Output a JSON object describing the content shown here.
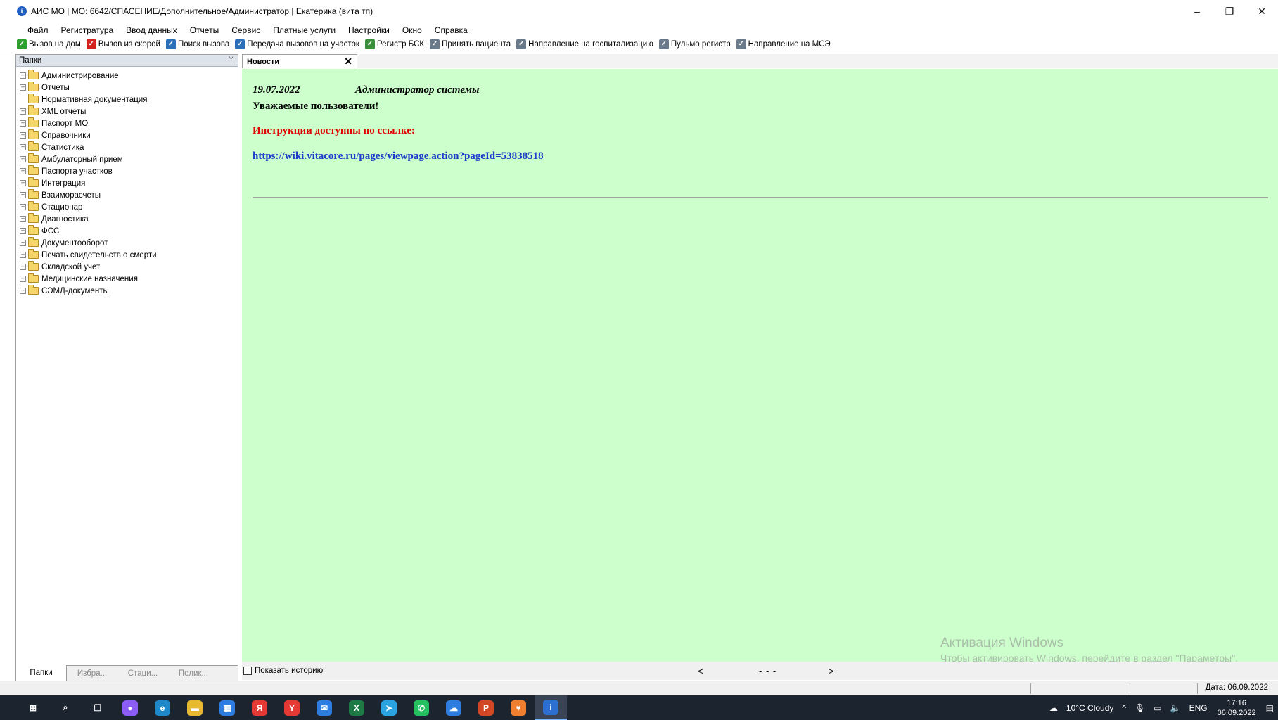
{
  "window": {
    "title": "АИС МО | МО: 6642/СПАСЕНИЕ/Дополнительное/Администратор | Екатерика (вита тп)",
    "minimize": "–",
    "restore": "❐",
    "close": "✕"
  },
  "menu": [
    "Файл",
    "Регистратура",
    "Ввод данных",
    "Отчеты",
    "Сервис",
    "Платные услуги",
    "Настройки",
    "Окно",
    "Справка"
  ],
  "toolbar": [
    {
      "label": "Вызов на дом",
      "icon": "checkmark-icon",
      "color": "#2e9e2e"
    },
    {
      "label": "Вызов из скорой",
      "icon": "ambulance-check-icon",
      "color": "#d22020"
    },
    {
      "label": "Поиск вызова",
      "icon": "search-call-icon",
      "color": "#2a6fb8"
    },
    {
      "label": "Передача вызовов на участок",
      "icon": "transfer-icon",
      "color": "#2a6fb8"
    },
    {
      "label": "Регистр БСК",
      "icon": "register-icon",
      "color": "#3a8f3a"
    },
    {
      "label": "Принять пациента",
      "icon": "accept-patient-icon",
      "color": "#6a7a8a"
    },
    {
      "label": "Направление на госпитализацию",
      "icon": "hospitalization-icon",
      "color": "#6a7a8a"
    },
    {
      "label": "Пульмо регистр",
      "icon": "lungs-icon",
      "color": "#6a7a8a"
    },
    {
      "label": "Направление на МСЭ",
      "icon": "mse-referral-icon",
      "color": "#6a7a8a"
    }
  ],
  "left_panel": {
    "title": "Папки",
    "pin": "📌",
    "folders": [
      {
        "label": "Администрирование",
        "expandable": true
      },
      {
        "label": "Отчеты",
        "expandable": true
      },
      {
        "label": "Нормативная документация",
        "expandable": false
      },
      {
        "label": "XML отчеты",
        "expandable": true
      },
      {
        "label": "Паспорт МО",
        "expandable": true
      },
      {
        "label": "Справочники",
        "expandable": true
      },
      {
        "label": "Статистика",
        "expandable": true
      },
      {
        "label": "Амбулаторный прием",
        "expandable": true
      },
      {
        "label": "Паспорта участков",
        "expandable": true
      },
      {
        "label": "Интеграция",
        "expandable": true
      },
      {
        "label": "Взаиморасчеты",
        "expandable": true
      },
      {
        "label": "Стационар",
        "expandable": true
      },
      {
        "label": "Диагностика",
        "expandable": true
      },
      {
        "label": "ФСС",
        "expandable": true
      },
      {
        "label": "Документооборот",
        "expandable": true
      },
      {
        "label": "Печать свидетельств о смерти",
        "expandable": true
      },
      {
        "label": "Складской учет",
        "expandable": true
      },
      {
        "label": "Медицинские назначения",
        "expandable": true
      },
      {
        "label": "СЭМД-документы",
        "expandable": true
      }
    ],
    "bottom_tabs": [
      "Папки",
      "Избра...",
      "Стаци...",
      "Полик..."
    ]
  },
  "doc_tab": {
    "label": "Новости",
    "close": "✕"
  },
  "news": {
    "date": "19.07.2022",
    "author": "Администратор системы",
    "greeting": "Уважаемые пользователи!",
    "instructions": "Инструкции доступны по ссылке:",
    "link": "https://wiki.vitacore.ru/pages/viewpage.action?pageId=53838518"
  },
  "activation": {
    "title": "Активация Windows",
    "subtitle": "Чтобы активировать Windows, перейдите в раздел \"Параметры\"."
  },
  "footer": {
    "show_history": "Показать историю",
    "prev": "<",
    "middle": "- - -",
    "next": ">"
  },
  "statusbar": {
    "date": "Дата: 06.09.2022"
  },
  "taskbar": {
    "apps": [
      {
        "name": "windows-start-icon",
        "color": "#1c2430",
        "glyph": "⊞"
      },
      {
        "name": "search-icon",
        "color": "#1c2430",
        "glyph": "⌕"
      },
      {
        "name": "task-view-icon",
        "color": "#1c2430",
        "glyph": "❐"
      },
      {
        "name": "alice-icon",
        "color": "#8b5cf6",
        "glyph": "●"
      },
      {
        "name": "edge-icon",
        "color": "#1e88c8",
        "glyph": "e"
      },
      {
        "name": "file-explorer-icon",
        "color": "#e8b830",
        "glyph": "▬"
      },
      {
        "name": "store-icon",
        "color": "#2d7de0",
        "glyph": "▦"
      },
      {
        "name": "yandex-icon",
        "color": "#e53935",
        "glyph": "Я"
      },
      {
        "name": "yandex-browser-icon",
        "color": "#e53935",
        "glyph": "Y"
      },
      {
        "name": "mail-icon",
        "color": "#2d7de0",
        "glyph": "✉"
      },
      {
        "name": "excel-icon",
        "color": "#1d7a45",
        "glyph": "X"
      },
      {
        "name": "telegram-icon",
        "color": "#2aa3e0",
        "glyph": "➤"
      },
      {
        "name": "whatsapp-icon",
        "color": "#25c060",
        "glyph": "✆"
      },
      {
        "name": "onedrive-icon",
        "color": "#2d7de0",
        "glyph": "☁"
      },
      {
        "name": "powerpoint-icon",
        "color": "#d24726",
        "glyph": "P"
      },
      {
        "name": "heart-app-icon",
        "color": "#f08030",
        "glyph": "♥"
      },
      {
        "name": "ais-mo-icon",
        "color": "#2d6fd0",
        "glyph": "i"
      }
    ],
    "weather": "10°C  Cloudy",
    "language": "ENG",
    "time": "17:16",
    "date": "06.09.2022"
  }
}
